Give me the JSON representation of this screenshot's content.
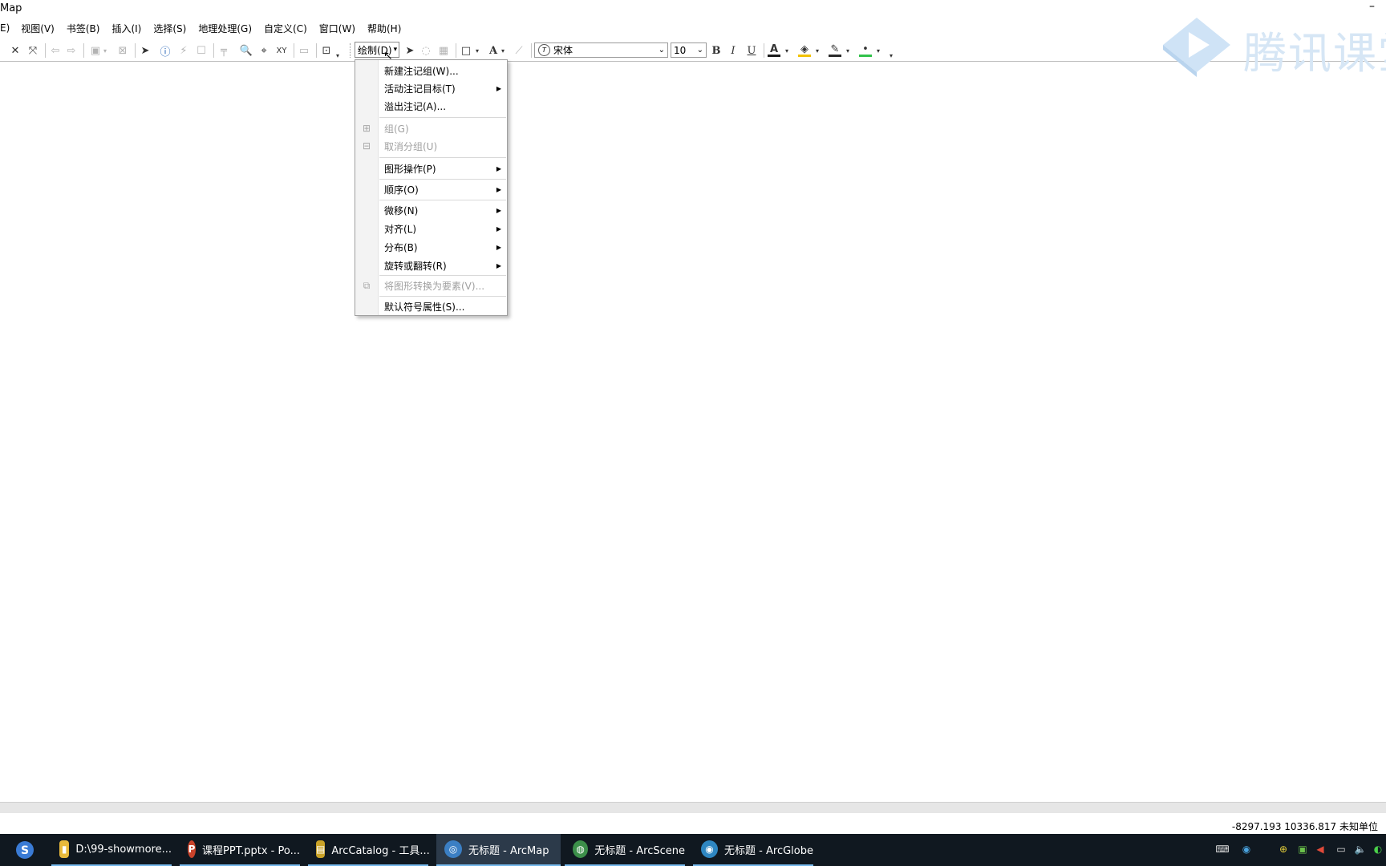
{
  "window": {
    "title": "Map",
    "minimize_glyph": "–"
  },
  "menubar": {
    "items": [
      {
        "name": "menu-partial",
        "label": "E)"
      },
      {
        "name": "menu-view",
        "label": "视图(V)"
      },
      {
        "name": "menu-bookmarks",
        "label": "书签(B)"
      },
      {
        "name": "menu-insert",
        "label": "插入(I)"
      },
      {
        "name": "menu-select",
        "label": "选择(S)"
      },
      {
        "name": "menu-geoprocessing",
        "label": "地理处理(G)"
      },
      {
        "name": "menu-customize",
        "label": "自定义(C)"
      },
      {
        "name": "menu-window",
        "label": "窗口(W)"
      },
      {
        "name": "menu-help",
        "label": "帮助(H)"
      }
    ]
  },
  "draw_toolbar": {
    "draw_label": "绘制(D)",
    "font_name": "宋体",
    "font_size": "10",
    "bold_label": "B",
    "italic_label": "I",
    "underline_label": "U",
    "text_tool_label": "A",
    "font_color": "#1a1a1a",
    "fill_color": "#f2c200",
    "line_color": "#2a2a2a",
    "marker_color": "#31c24a"
  },
  "watermark": {
    "text": "腾讯课堂"
  },
  "draw_menu": {
    "items": [
      {
        "name": "menu-new-annotation-group",
        "label": "新建注记组(W)...",
        "submenu": false,
        "disabled": false
      },
      {
        "name": "menu-active-annotation-target",
        "label": "活动注记目标(T)",
        "submenu": true,
        "disabled": false
      },
      {
        "name": "menu-overflow-annotation",
        "label": "溢出注记(A)...",
        "submenu": false,
        "disabled": false
      },
      {
        "name": "menu-group",
        "label": "组(G)",
        "submenu": false,
        "disabled": true,
        "icon": "group-icon"
      },
      {
        "name": "menu-ungroup",
        "label": "取消分组(U)",
        "submenu": false,
        "disabled": true,
        "icon": "ungroup-icon"
      },
      {
        "name": "menu-graphic-operations",
        "label": "图形操作(P)",
        "submenu": true,
        "disabled": false
      },
      {
        "name": "menu-order",
        "label": "顺序(O)",
        "submenu": true,
        "disabled": false
      },
      {
        "name": "menu-nudge",
        "label": "微移(N)",
        "submenu": true,
        "disabled": false
      },
      {
        "name": "menu-align",
        "label": "对齐(L)",
        "submenu": true,
        "disabled": false
      },
      {
        "name": "menu-distribute",
        "label": "分布(B)",
        "submenu": true,
        "disabled": false
      },
      {
        "name": "menu-rotate-flip",
        "label": "旋转或翻转(R)",
        "submenu": true,
        "disabled": false
      },
      {
        "name": "menu-convert-graphics",
        "label": "将图形转换为要素(V)...",
        "submenu": false,
        "disabled": true,
        "icon": "convert-graphics-icon"
      },
      {
        "name": "menu-default-symbol-properties",
        "label": "默认符号属性(S)...",
        "submenu": false,
        "disabled": false
      }
    ]
  },
  "status": {
    "coordinates": "-8297.193  10336.817 未知单位"
  },
  "taskbar": {
    "items": [
      {
        "name": "taskbar-explorer",
        "label": "D:\\99-showmore...",
        "color": "#e8b93b",
        "glyph": "▮"
      },
      {
        "name": "taskbar-powerpoint",
        "label": "课程PPT.pptx - Po...",
        "color": "#c9432b",
        "glyph": "P"
      },
      {
        "name": "taskbar-arccatalog",
        "label": "ArcCatalog - 工具...",
        "color": "#c9a227",
        "glyph": "▤"
      },
      {
        "name": "taskbar-arcmap",
        "label": "无标题 - ArcMap",
        "color": "#3b7fc4",
        "glyph": "◎"
      },
      {
        "name": "taskbar-arcscene",
        "label": "无标题 - ArcScene",
        "color": "#3c8f4a",
        "glyph": "◍"
      },
      {
        "name": "taskbar-arcglobe",
        "label": "无标题 - ArcGlobe",
        "color": "#2e86c1",
        "glyph": "◉"
      }
    ]
  }
}
